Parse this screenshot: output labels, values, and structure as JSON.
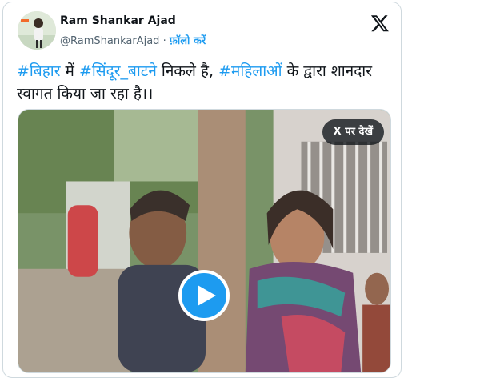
{
  "author": {
    "display_name": "Ram Shankar Ajad",
    "handle": "@RamShankarAjad",
    "separator": "·",
    "follow_label": "फ़ॉलो करें"
  },
  "tweet": {
    "part1_hashtag": "#बिहार",
    "part2": " में ",
    "part3_hashtag": "#सिंदूर_बाटने",
    "part4": " निकले है, ",
    "part5_hashtag": "#महिलाओं",
    "part6": " के द्वारा शानदार स्वागत किया जा रहा है।।"
  },
  "media": {
    "watch_on_x_label": "X पर देखें",
    "type": "video"
  },
  "icons": {
    "platform_logo": "x-logo-icon",
    "play": "play-icon"
  },
  "colors": {
    "link": "#1d9bf0",
    "text": "#0f1419",
    "muted": "#536471",
    "border": "#cfd9de"
  }
}
